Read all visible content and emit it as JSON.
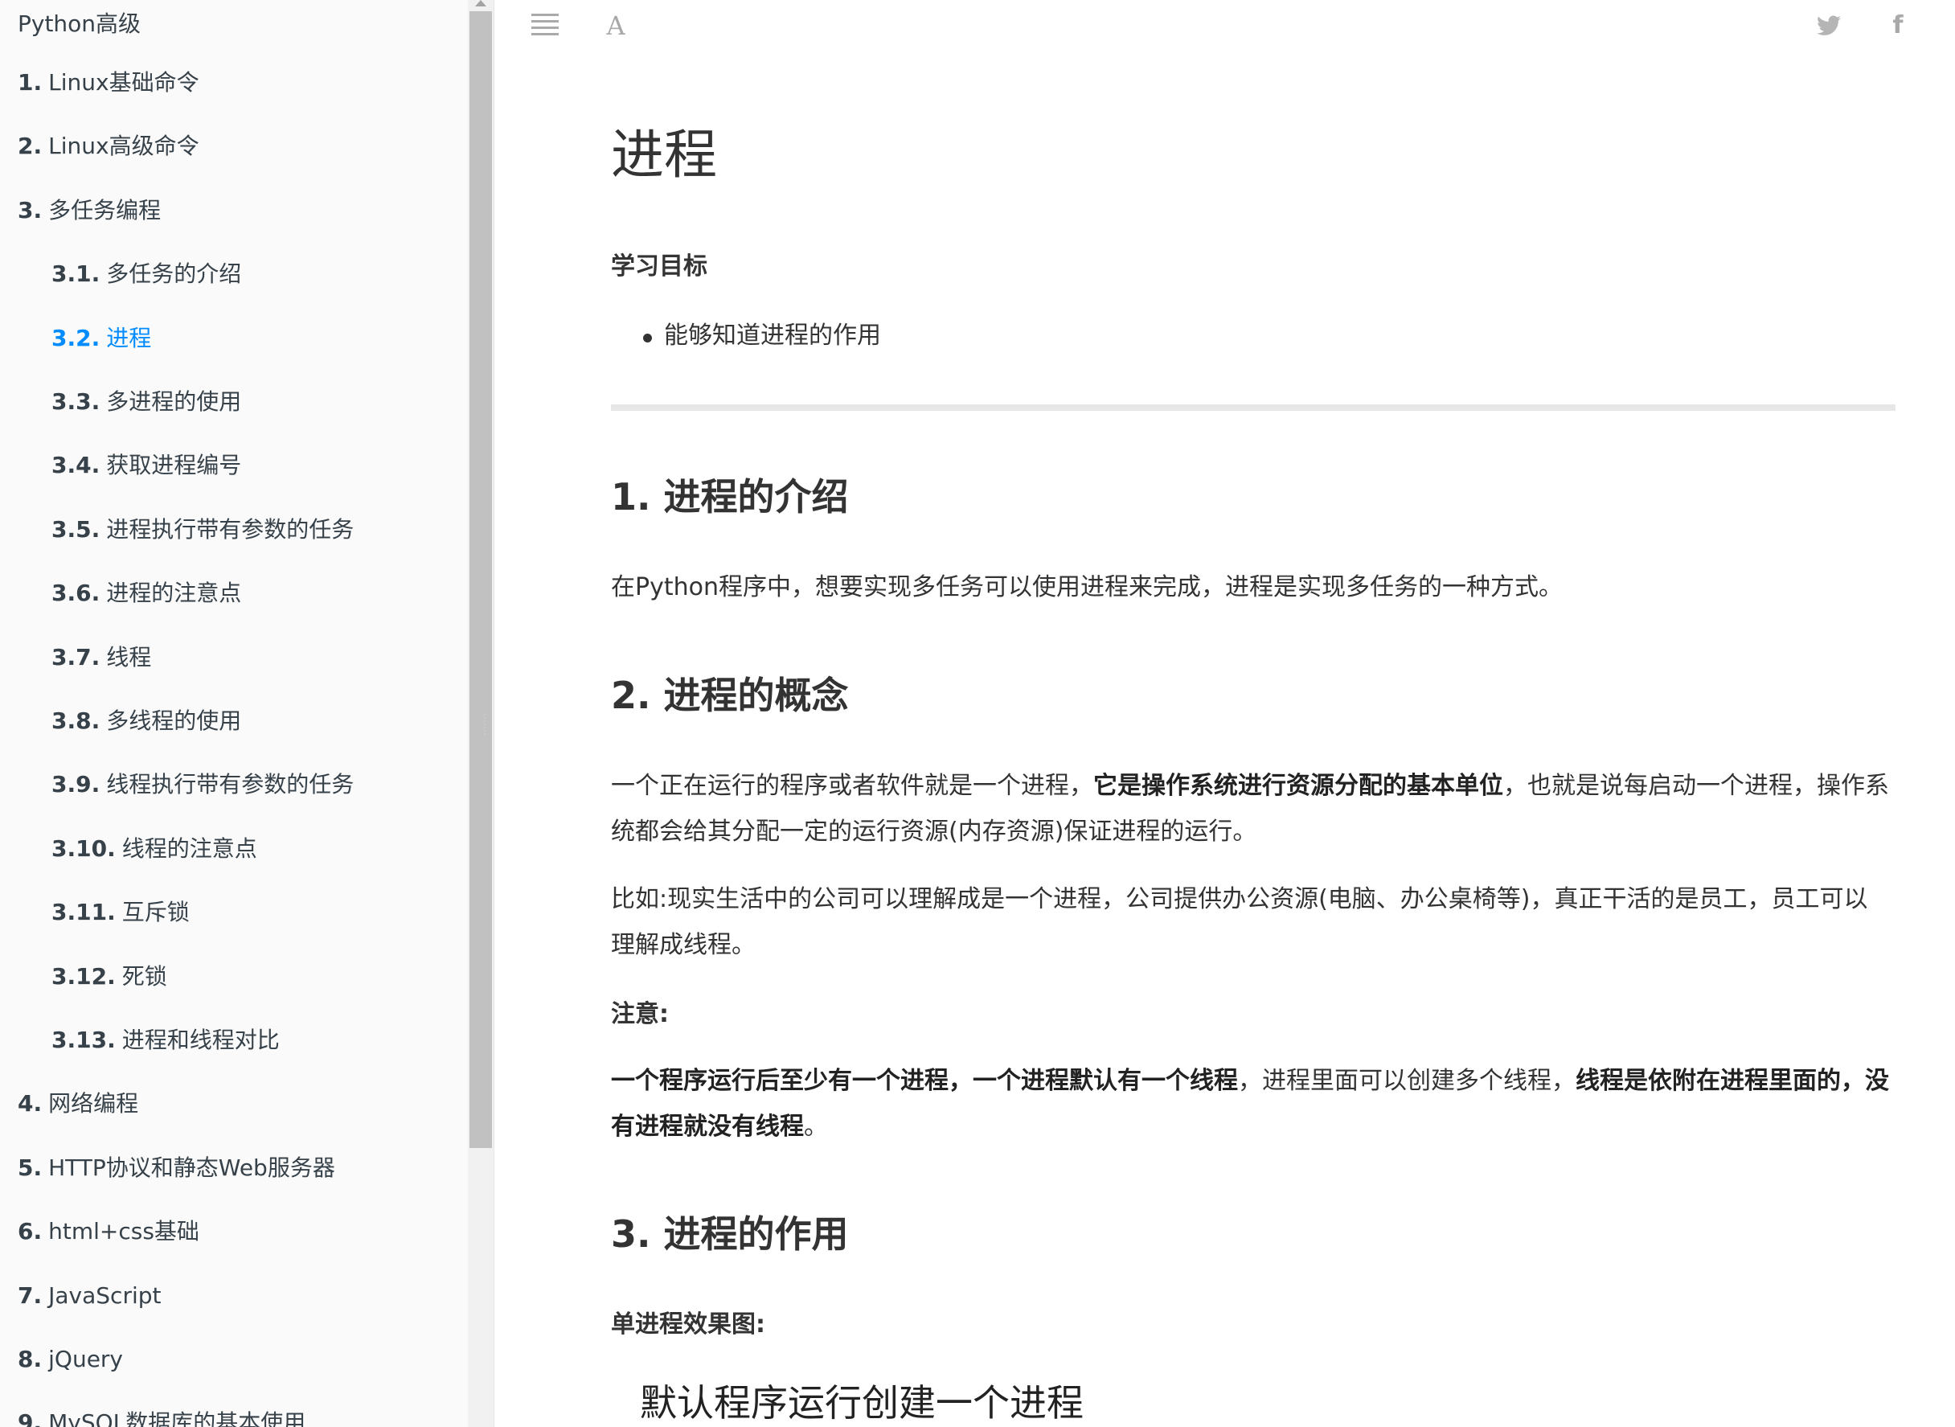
{
  "sidebar": {
    "title": "Python高级",
    "items": [
      {
        "num": "1.",
        "label": "Linux基础命令",
        "level": 0
      },
      {
        "num": "2.",
        "label": "Linux高级命令",
        "level": 0
      },
      {
        "num": "3.",
        "label": "多任务编程",
        "level": 0
      },
      {
        "num": "3.1.",
        "label": "多任务的介绍",
        "level": 1
      },
      {
        "num": "3.2.",
        "label": "进程",
        "level": 1,
        "active": true
      },
      {
        "num": "3.3.",
        "label": "多进程的使用",
        "level": 1
      },
      {
        "num": "3.4.",
        "label": "获取进程编号",
        "level": 1
      },
      {
        "num": "3.5.",
        "label": "进程执行带有参数的任务",
        "level": 1
      },
      {
        "num": "3.6.",
        "label": "进程的注意点",
        "level": 1
      },
      {
        "num": "3.7.",
        "label": "线程",
        "level": 1
      },
      {
        "num": "3.8.",
        "label": "多线程的使用",
        "level": 1
      },
      {
        "num": "3.9.",
        "label": "线程执行带有参数的任务",
        "level": 1
      },
      {
        "num": "3.10.",
        "label": "线程的注意点",
        "level": 1
      },
      {
        "num": "3.11.",
        "label": "互斥锁",
        "level": 1
      },
      {
        "num": "3.12.",
        "label": "死锁",
        "level": 1
      },
      {
        "num": "3.13.",
        "label": "进程和线程对比",
        "level": 1
      },
      {
        "num": "4.",
        "label": "网络编程",
        "level": 0
      },
      {
        "num": "5.",
        "label": "HTTP协议和静态Web服务器",
        "level": 0
      },
      {
        "num": "6.",
        "label": "html+css基础",
        "level": 0
      },
      {
        "num": "7.",
        "label": "JavaScript",
        "level": 0
      },
      {
        "num": "8.",
        "label": "jQuery",
        "level": 0
      },
      {
        "num": "9.",
        "label": "MySQL数据库的基本使用",
        "level": 0
      }
    ]
  },
  "toolbar": {
    "menu_icon": "hamburger-menu-icon",
    "font_icon": "font-settings-icon",
    "font_glyph": "A",
    "twitter_icon": "twitter-icon",
    "facebook_icon": "facebook-icon",
    "facebook_glyph": "f"
  },
  "content": {
    "title": "进程",
    "goal_heading": "学习目标",
    "goals": [
      "能够知道进程的作用"
    ],
    "sections": {
      "intro": {
        "heading": "1. 进程的介绍",
        "text": "在Python程序中，想要实现多任务可以使用进程来完成，进程是实现多任务的一种方式。"
      },
      "concept": {
        "heading": "2. 进程的概念",
        "p1_a": "一个正在运行的程序或者软件就是一个进程，",
        "p1_bold": "它是操作系统进行资源分配的基本单位",
        "p1_b": "，也就是说每启动一个进程，操作系统都会给其分配一定的运行资源(内存资源)保证进程的运行。",
        "p2": "比如:现实生活中的公司可以理解成是一个进程，公司提供办公资源(电脑、办公桌椅等)，真正干活的是员工，员工可以理解成线程。",
        "note_label": "注意:",
        "note_bold1": "一个程序运行后至少有一个进程，一个进程默认有一个线程",
        "note_mid": "，进程里面可以创建多个线程，",
        "note_bold2": "线程是依附在进程里面的，没有进程就没有线程",
        "note_end": "。"
      },
      "role": {
        "heading": "3. 进程的作用",
        "single_label": "单进程效果图:",
        "figure_title": "默认程序运行创建一个进程"
      }
    }
  },
  "colors": {
    "accent": "#008cff",
    "sidebar_bg": "#fafafa",
    "text": "#333333",
    "icon": "#a9a9a9"
  }
}
